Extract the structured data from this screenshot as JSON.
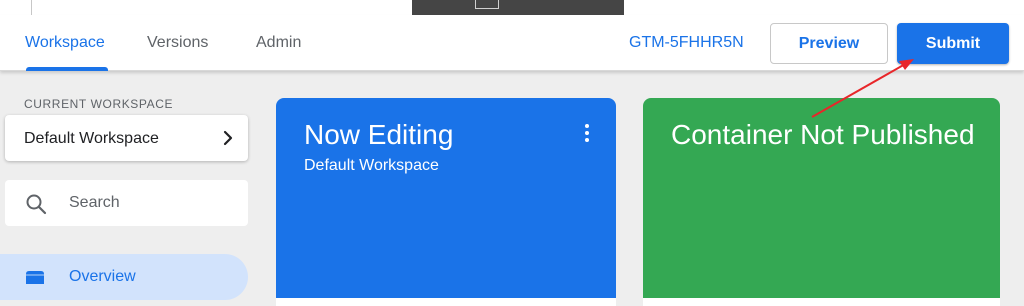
{
  "header": {
    "tabs": [
      {
        "label": "Workspace",
        "active": true
      },
      {
        "label": "Versions",
        "active": false
      },
      {
        "label": "Admin",
        "active": false
      }
    ],
    "container_id": "GTM-5FHHR5N",
    "preview_label": "Preview",
    "submit_label": "Submit"
  },
  "sidebar": {
    "current_workspace_label": "CURRENT WORKSPACE",
    "workspace_name": "Default Workspace",
    "search_placeholder": "Search",
    "nav": [
      {
        "label": "Overview",
        "icon": "folder-icon",
        "active": true
      }
    ]
  },
  "cards": {
    "editing": {
      "title": "Now Editing",
      "subtitle": "Default Workspace",
      "color": "#1a73e8"
    },
    "publish": {
      "title": "Container Not Published",
      "color": "#34a853"
    }
  },
  "annotation": {
    "arrow_color": "#e8262a",
    "points_to": "submit-button"
  },
  "colors": {
    "accent": "#1a73e8",
    "selected_nav": "#d2e3fc",
    "background": "#eeeeee"
  }
}
